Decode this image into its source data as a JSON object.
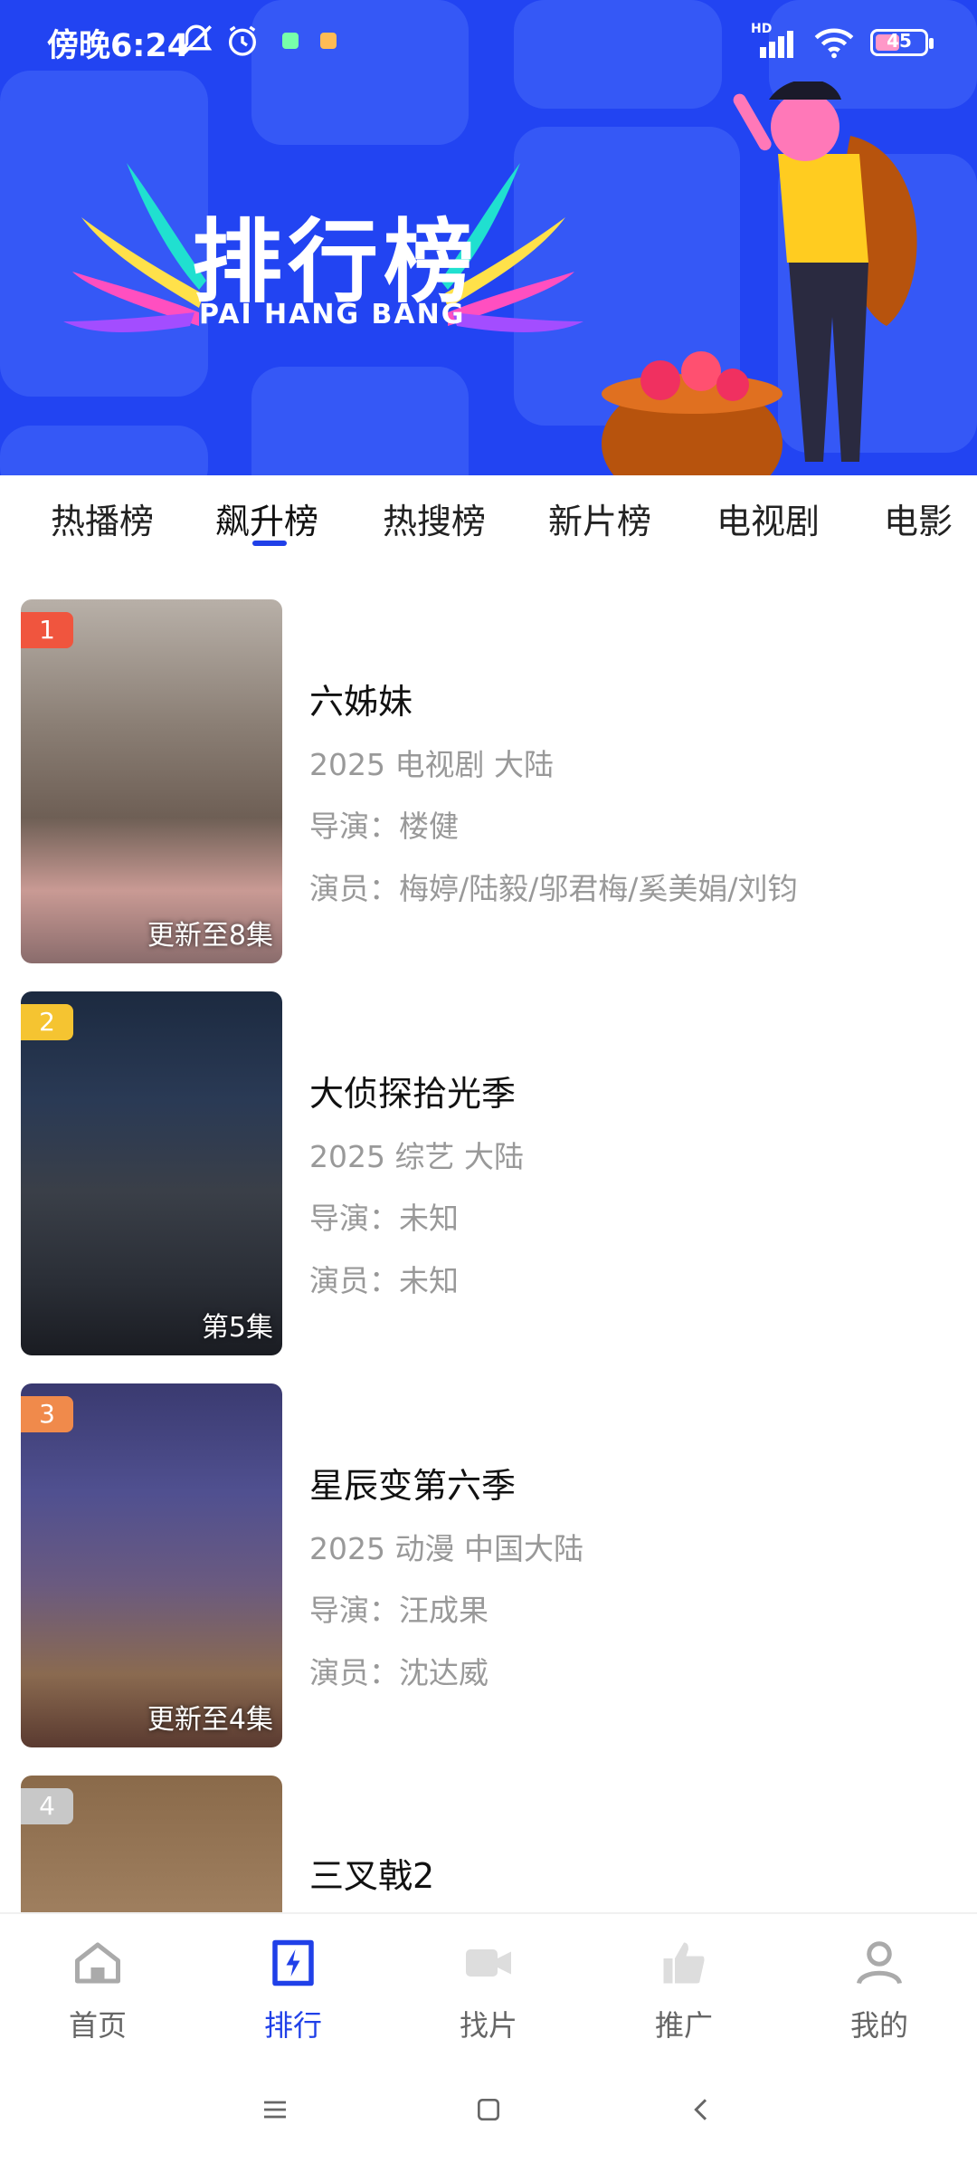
{
  "status_bar": {
    "time": "傍晚6:24",
    "battery": "45",
    "signal_label": "HD"
  },
  "banner": {
    "title": "排行榜",
    "subtitle": "PAI HANG BANG"
  },
  "tabs": [
    {
      "label": "热播榜",
      "active": false
    },
    {
      "label": "飙升榜",
      "active": true
    },
    {
      "label": "热搜榜",
      "active": false
    },
    {
      "label": "新片榜",
      "active": false
    },
    {
      "label": "电视剧",
      "active": false
    },
    {
      "label": "电影",
      "active": false
    }
  ],
  "items": [
    {
      "rank": "1",
      "rank_color": "#f0553e",
      "title": "六姊妹",
      "info": "2025 电视剧 大陆",
      "director": "导演：楼健",
      "cast": "演员：梅婷/陆毅/邬君梅/奚美娟/刘钧",
      "episode": "更新至8集"
    },
    {
      "rank": "2",
      "rank_color": "#f5c431",
      "title": "大侦探拾光季",
      "info": "2025 综艺 大陆",
      "director": "导演：未知",
      "cast": "演员：未知",
      "episode": "第5集"
    },
    {
      "rank": "3",
      "rank_color": "#f08a4b",
      "title": "星辰变第六季",
      "info": "2025 动漫 中国大陆",
      "director": "导演：汪成果",
      "cast": "演员：沈达威",
      "episode": "更新至4集"
    },
    {
      "rank": "4",
      "rank_color": "#c8c8c8",
      "title": "三叉戟2",
      "info": "",
      "director": "",
      "cast": "",
      "episode": ""
    }
  ],
  "bottom_nav": [
    {
      "label": "首页",
      "icon": "home-icon",
      "active": false
    },
    {
      "label": "排行",
      "icon": "ranking-icon",
      "active": true
    },
    {
      "label": "找片",
      "icon": "video-camera-icon",
      "active": false
    },
    {
      "label": "推广",
      "icon": "thumbs-up-icon",
      "active": false
    },
    {
      "label": "我的",
      "icon": "user-icon",
      "active": false
    }
  ],
  "colors": {
    "brand": "#2244f2",
    "accent": "#2040e8",
    "muted_text": "#999999"
  }
}
